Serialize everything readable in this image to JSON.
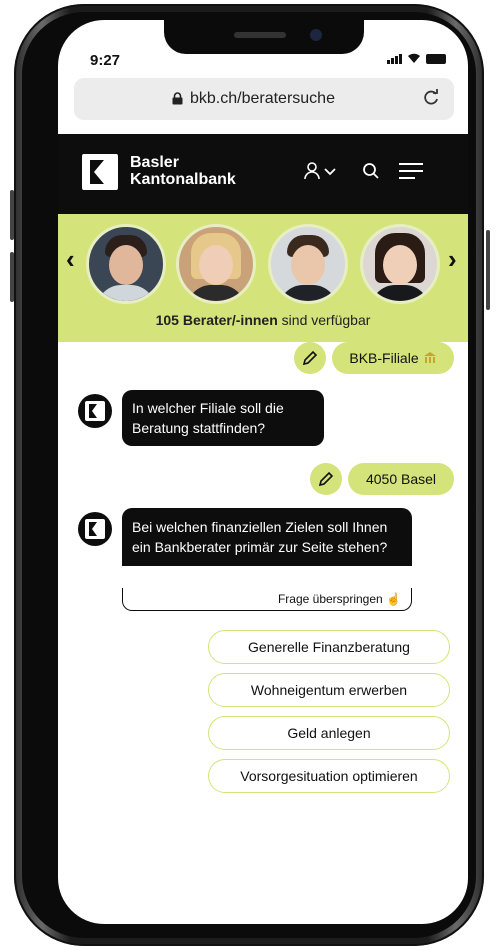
{
  "status_bar": {
    "time": "9:27"
  },
  "browser": {
    "url": "bkb.ch/beratersuche",
    "lock_icon": "lock-icon",
    "reload_icon": "reload-icon"
  },
  "header": {
    "brand_line1": "Basler",
    "brand_line2": "Kantonalbank",
    "icons": [
      "user-icon",
      "chevron-down-icon",
      "search-icon",
      "menu-icon"
    ]
  },
  "advisors": {
    "count_label": "105 Berater/-innen",
    "count_suffix": " sind verfügbar",
    "prev_arrow": "‹",
    "next_arrow": "›"
  },
  "chat": {
    "answer_1": "BKB-Filiale",
    "question_1": "In welcher Filiale soll die Beratung stattfinden?",
    "answer_2": "4050 Basel",
    "question_2": "Bei welchen finanziellen Zielen soll Ihnen ein Bankberater primär zur Seite stehen?",
    "skip_label": "Frage überspringen"
  },
  "options": [
    {
      "label": "Generelle Finanzberatung"
    },
    {
      "label": "Wohneigentum erwerben"
    },
    {
      "label": "Geld anlegen"
    },
    {
      "label": "Vorsorgesituation optimieren"
    }
  ],
  "colors": {
    "accent": "#d4e37a",
    "dark": "#0d0d0d"
  }
}
